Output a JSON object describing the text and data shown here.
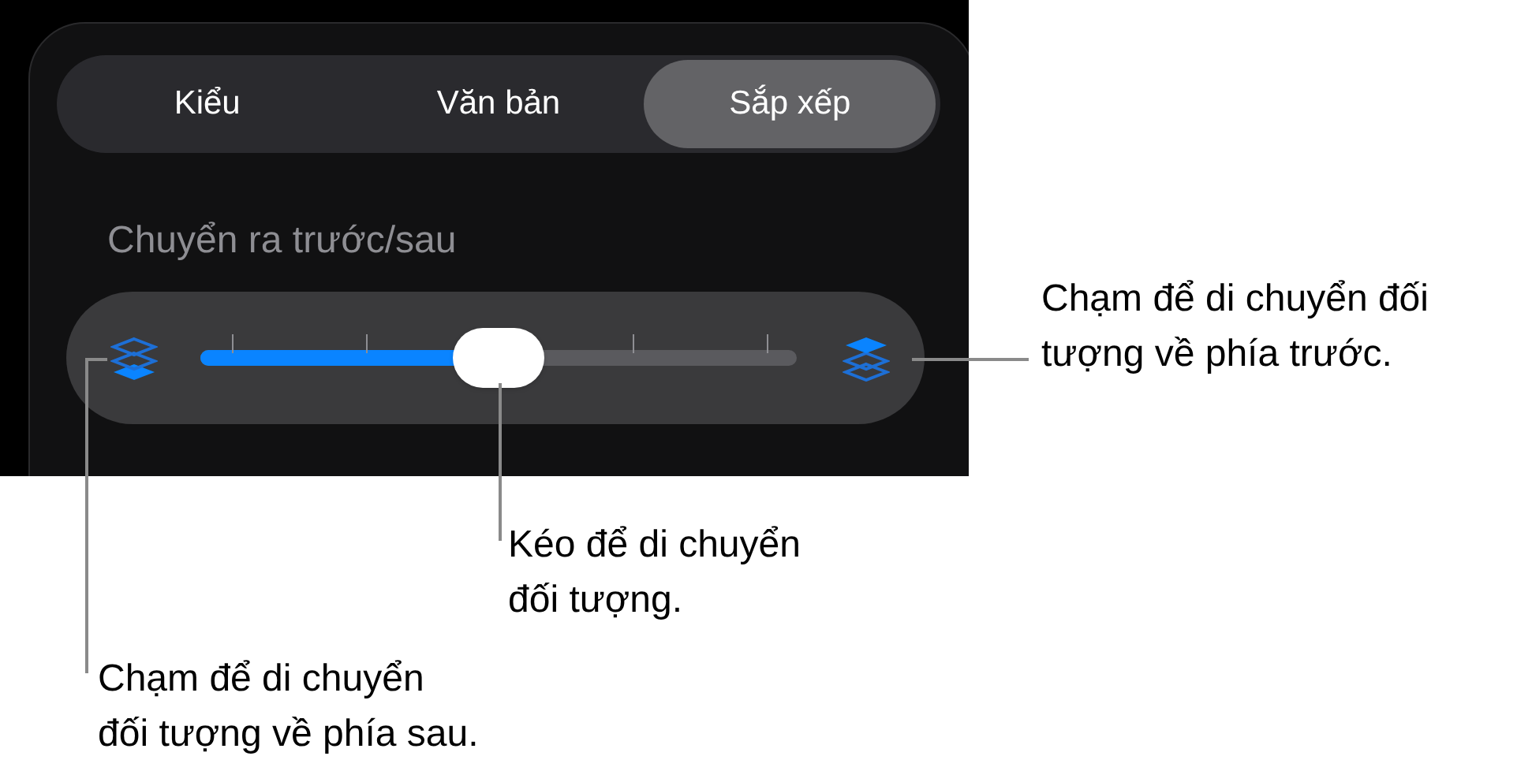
{
  "tabs": [
    {
      "label": "Kiểu",
      "selected": false
    },
    {
      "label": "Văn bản",
      "selected": false
    },
    {
      "label": "Sắp xếp",
      "selected": true
    }
  ],
  "section_label": "Chuyển ra trước/sau",
  "arrange_slider": {
    "level": 0.5
  },
  "callouts": [
    {
      "text": "Chạm để di chuyển đối tượng về phía trước."
    },
    {
      "text": "Kéo để di chuyển đối tượng."
    },
    {
      "text": "Chạm để di chuyển đối tượng về phía sau."
    }
  ]
}
